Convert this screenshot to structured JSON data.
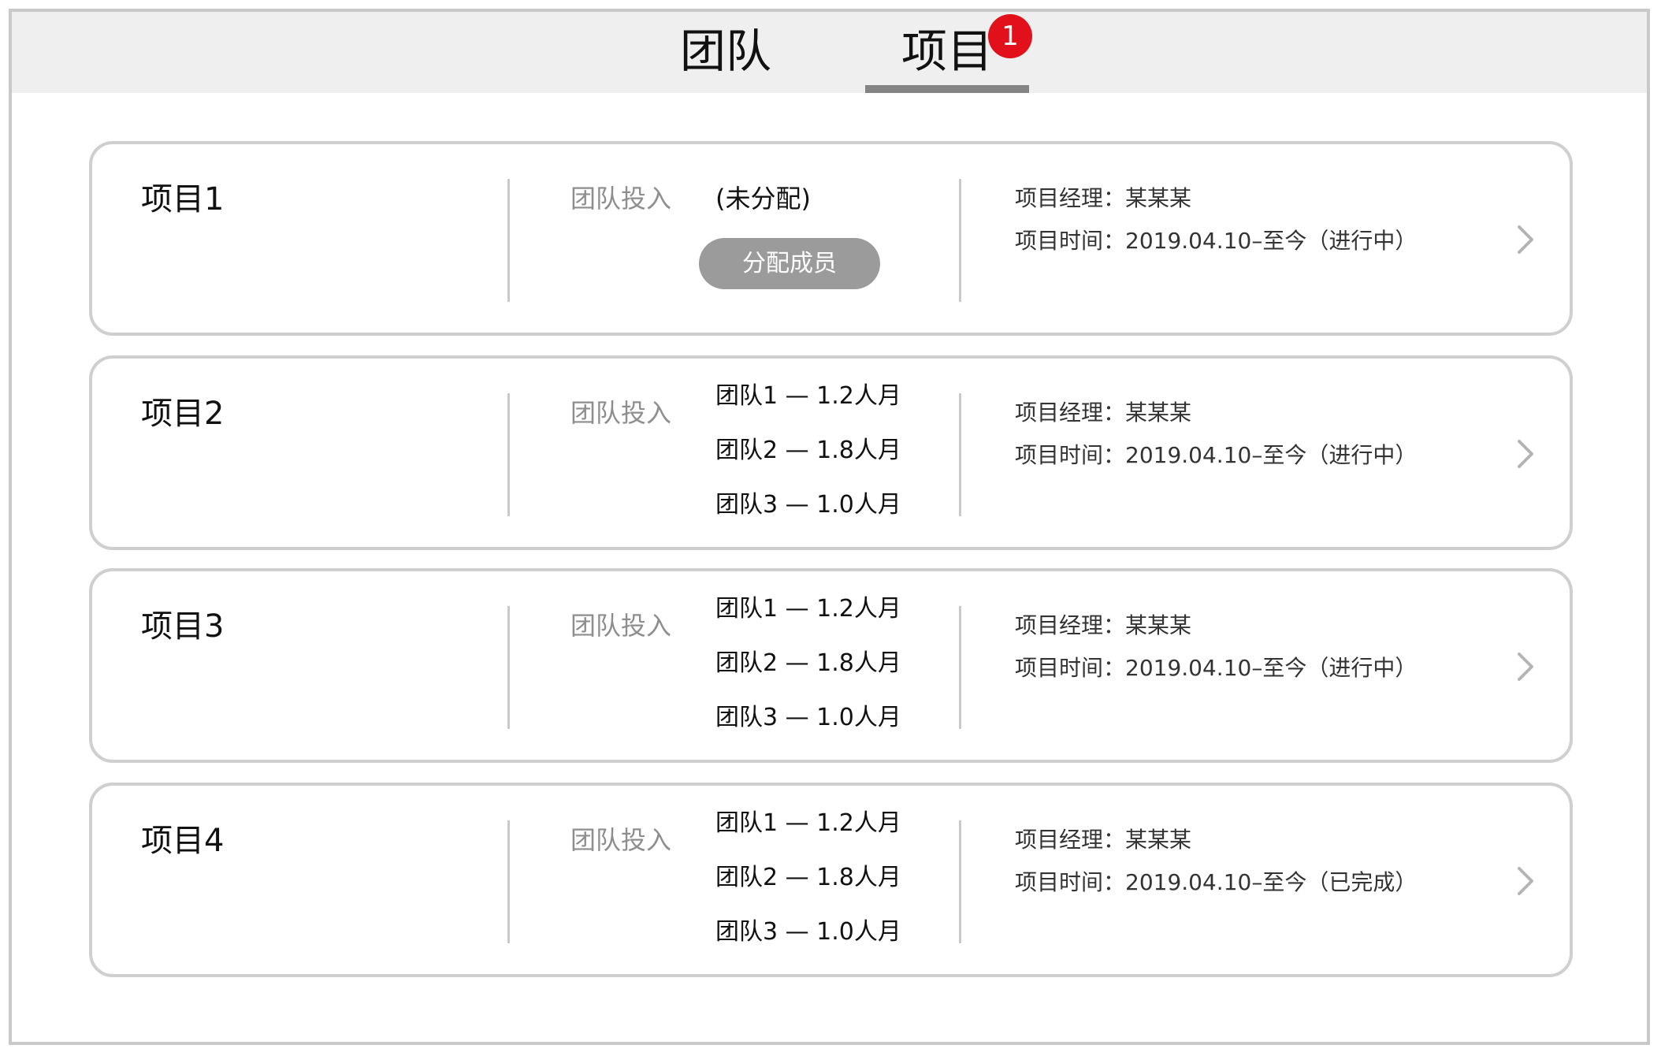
{
  "tabs": {
    "team_label": "团队",
    "project_label": "项目",
    "project_badge": "1",
    "active": "项目"
  },
  "colors": {
    "badge": "#e1101b",
    "tab_underline": "#848484",
    "assign_button": "#9b9b9b",
    "tabbar_bg": "#efefef",
    "card_border": "#cfcfcf"
  },
  "projects": [
    {
      "name": "项目1",
      "investment_label": "团队投入",
      "unassigned": "(未分配)",
      "assign_button": "分配成员",
      "teams": [],
      "manager": "项目经理：某某某",
      "time": "项目时间：2019.04.10–至今（进行中）",
      "chevron_icon": "chevron-right-icon"
    },
    {
      "name": "项目2",
      "investment_label": "团队投入",
      "teams": [
        "团队1 — 1.2人月",
        "团队2 — 1.8人月",
        "团队3 — 1.0人月"
      ],
      "manager": "项目经理：某某某",
      "time": "项目时间：2019.04.10–至今（进行中）",
      "chevron_icon": "chevron-right-icon"
    },
    {
      "name": "项目3",
      "investment_label": "团队投入",
      "teams": [
        "团队1 — 1.2人月",
        "团队2 — 1.8人月",
        "团队3 — 1.0人月"
      ],
      "manager": "项目经理：某某某",
      "time": "项目时间：2019.04.10–至今（进行中）",
      "chevron_icon": "chevron-right-icon"
    },
    {
      "name": "项目4",
      "investment_label": "团队投入",
      "teams": [
        "团队1 — 1.2人月",
        "团队2 — 1.8人月",
        "团队3 — 1.0人月"
      ],
      "manager": "项目经理：某某某",
      "time": "项目时间：2019.04.10–至今（已完成）",
      "chevron_icon": "chevron-right-icon"
    }
  ]
}
